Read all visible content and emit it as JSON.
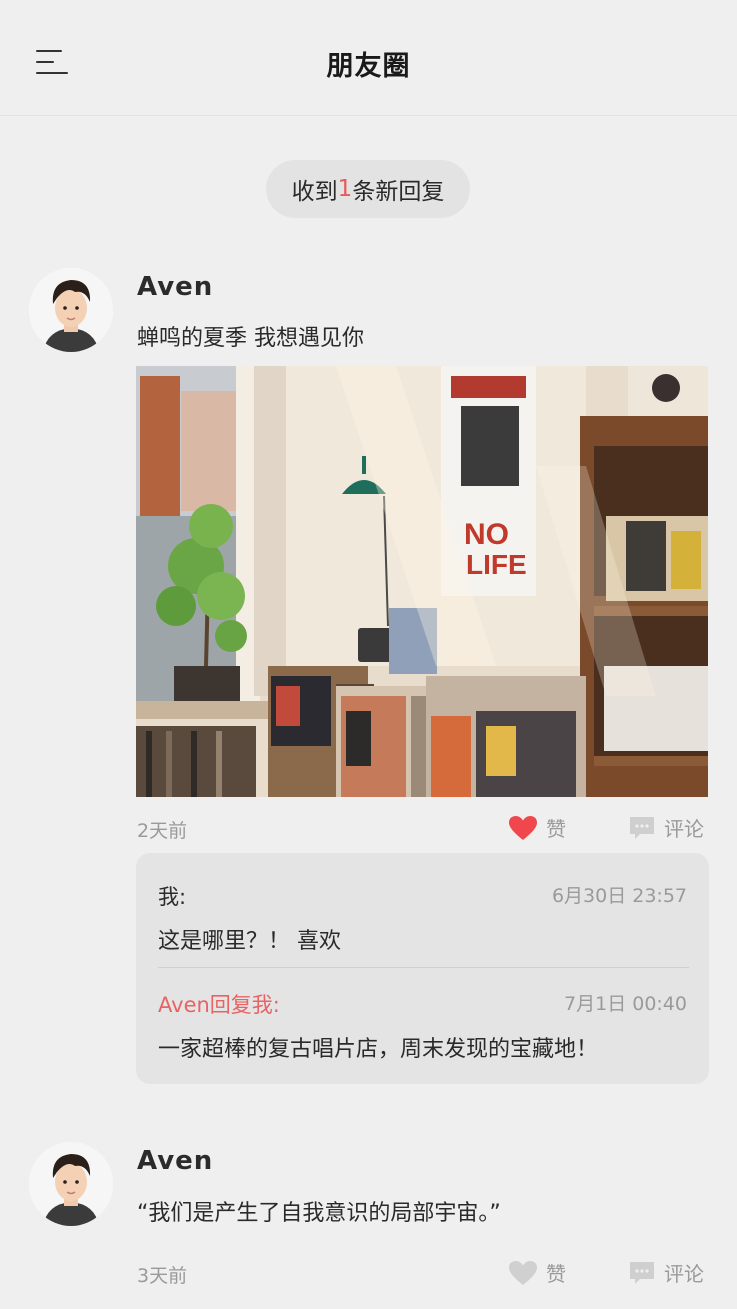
{
  "header": {
    "title": "朋友圈",
    "menu_icon": "menu-icon"
  },
  "notice": {
    "prefix": "收到",
    "count": "1",
    "suffix": "条新回复"
  },
  "colors": {
    "accent_red": "#e85a5a",
    "background": "#efefef",
    "comment_bg": "#e4e4e4"
  },
  "posts": [
    {
      "author": "Aven",
      "text": "蝉鸣的夏季 我想遇见你",
      "image": "record-store-photo",
      "time": "2天前",
      "like_label": "赞",
      "liked": true,
      "comment_label": "评论",
      "comments": [
        {
          "name": "我:",
          "time": "6月30日 23:57",
          "text": "这是哪里？！ 喜欢"
        },
        {
          "name": "Aven回复我:",
          "time": "7月1日 00:40",
          "text": "一家超棒的复古唱片店，周末发现的宝藏地！"
        }
      ]
    },
    {
      "author": "Aven",
      "text": "“我们是产生了自我意识的局部宇宙。”",
      "time": "3天前",
      "like_label": "赞",
      "liked": false,
      "comment_label": "评论"
    }
  ]
}
